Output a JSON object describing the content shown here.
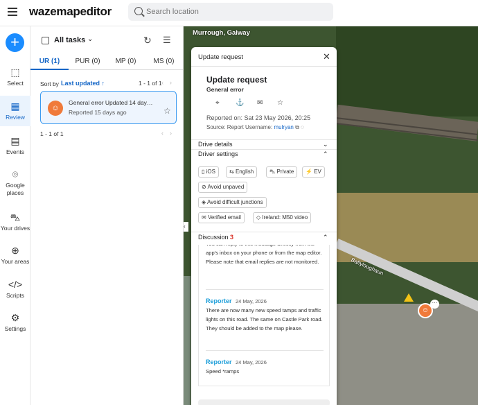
{
  "header": {
    "logo": "wazemapeditor",
    "search_placeholder": "Search location"
  },
  "rail": {
    "items": [
      {
        "label": "Select",
        "icon": "select-icon"
      },
      {
        "label": "Review",
        "icon": "review-icon"
      },
      {
        "label": "Events",
        "icon": "calendar-icon"
      },
      {
        "label": "Google places",
        "icon": "place-pin-icon"
      },
      {
        "label": "Your drives",
        "icon": "car-icon"
      },
      {
        "label": "Your areas",
        "icon": "globe-icon"
      },
      {
        "label": "Scripts",
        "icon": "code-icon"
      },
      {
        "label": "Settings",
        "icon": "gear-icon"
      }
    ],
    "active": "Review"
  },
  "tasks": {
    "title": "All tasks",
    "tabs": [
      "UR (1)",
      "PUR (0)",
      "MP (0)",
      "MS (0)"
    ],
    "sort_label": "Sort by",
    "sort_value": "Last updated ↑",
    "page_top": "1 - 1 of 1",
    "page_bottom": "1 - 1 of 1",
    "card": {
      "title": "General error Updated 14 days…",
      "subtitle": "Reported 15 days ago"
    }
  },
  "map": {
    "place": "Murrough, Galway",
    "road": "Ballyloughaun"
  },
  "dialog": {
    "header": "Update request",
    "title": "Update request",
    "subtitle": "General error",
    "reported": "Reported on: Sat 23 May 2026, 20:25",
    "source_label": "Source: Report",
    "username_label": "Username:",
    "username": "mulryan",
    "drive_details": "Drive details",
    "driver_settings": "Driver settings",
    "chips": [
      "iOS",
      "English",
      "Private",
      "EV",
      "Avoid unpaved",
      "Avoid difficult junctions",
      "Verified email",
      "Ireland: M50 video"
    ],
    "discussion_label": "Discussion",
    "discussion_count": "3",
    "messages": [
      {
        "text": "You can reply to this message directly from the app's inbox on your phone or from the map editor. Please note that email replies are not monitored."
      },
      {
        "name": "Reporter",
        "date": "24 May, 2026",
        "text": "There are now many new speed tamps and traffic lights on this road. The same on Castle Park road. They should be added to the map please."
      },
      {
        "name": "Reporter",
        "date": "24 May, 2026",
        "text": "Speed *ramps"
      }
    ]
  }
}
